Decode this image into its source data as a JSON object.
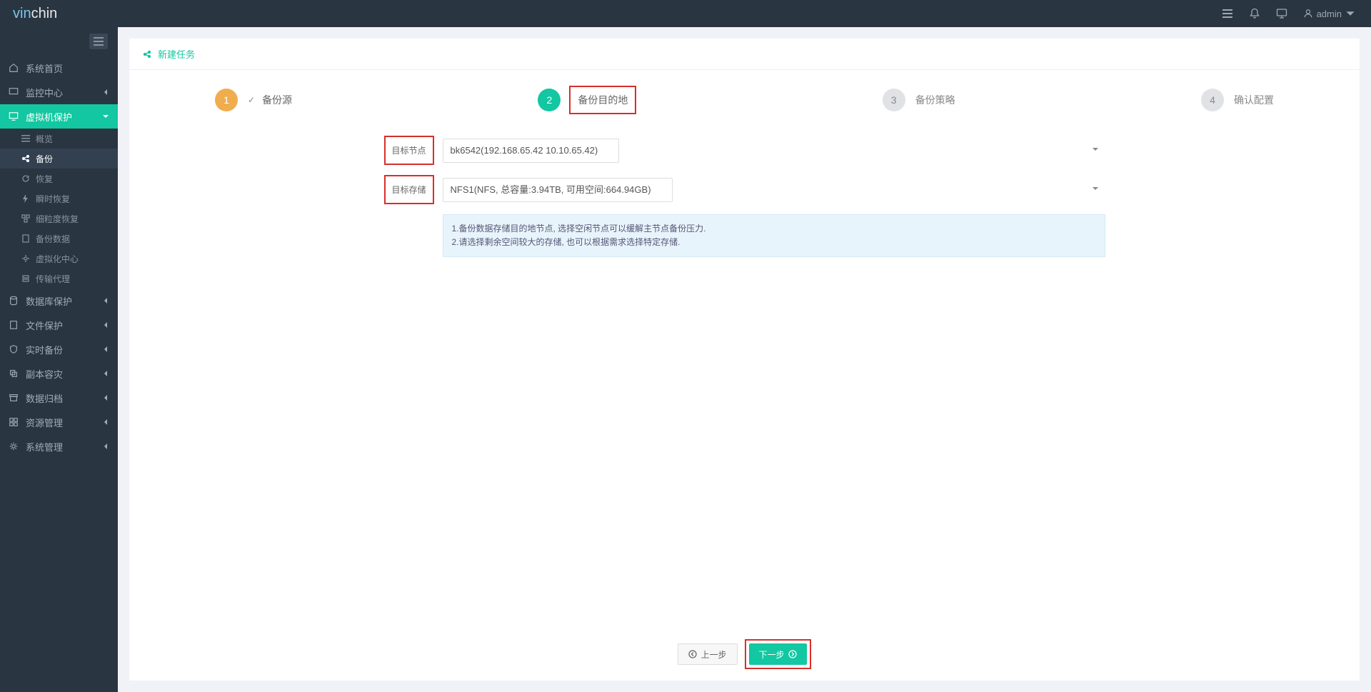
{
  "brand": {
    "pre": "vin",
    "post": "chin"
  },
  "user": {
    "name": "admin"
  },
  "page_title": "新建任务",
  "sidebar": {
    "items": [
      {
        "label": "系统首页"
      },
      {
        "label": "监控中心"
      },
      {
        "label": "虚拟机保护"
      },
      {
        "label": "数据库保护"
      },
      {
        "label": "文件保护"
      },
      {
        "label": "实时备份"
      },
      {
        "label": "副本容灾"
      },
      {
        "label": "数据归档"
      },
      {
        "label": "资源管理"
      },
      {
        "label": "系统管理"
      }
    ],
    "submenu": [
      {
        "label": "概览"
      },
      {
        "label": "备份"
      },
      {
        "label": "恢复"
      },
      {
        "label": "瞬时恢复"
      },
      {
        "label": "细粒度恢复"
      },
      {
        "label": "备份数据"
      },
      {
        "label": "虚拟化中心"
      },
      {
        "label": "传输代理"
      }
    ]
  },
  "steps": [
    {
      "num": "1",
      "label": "备份源"
    },
    {
      "num": "2",
      "label": "备份目的地"
    },
    {
      "num": "3",
      "label": "备份策略"
    },
    {
      "num": "4",
      "label": "确认配置"
    }
  ],
  "form": {
    "node_label": "目标节点",
    "node_value": "bk6542(192.168.65.42 10.10.65.42)",
    "storage_label": "目标存储",
    "storage_value": "NFS1(NFS, 总容量:3.94TB, 可用空间:664.94GB)",
    "hint1": "1.备份数据存储目的地节点, 选择空闲节点可以缓解主节点备份压力.",
    "hint2": "2.请选择剩余空间较大的存储, 也可以根据需求选择特定存储."
  },
  "buttons": {
    "prev": "上一步",
    "next": "下一步"
  }
}
